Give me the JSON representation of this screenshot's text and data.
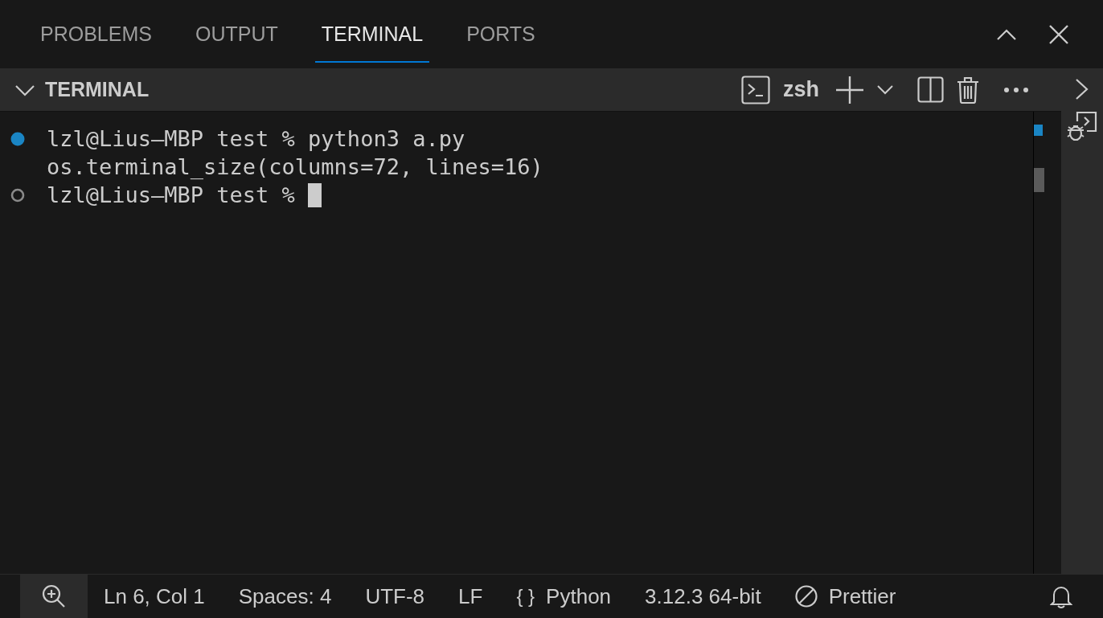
{
  "panel_tabs": [
    {
      "label": "PROBLEMS",
      "selected": false
    },
    {
      "label": "OUTPUT",
      "selected": false
    },
    {
      "label": "TERMINAL",
      "selected": true
    },
    {
      "label": "PORTS",
      "selected": false
    }
  ],
  "terminal_header": {
    "title": "TERMINAL",
    "shell": "zsh"
  },
  "terminal_lines": [
    {
      "kind": "command",
      "text": "lzl@Lius—MBP test % python3 a.py",
      "cursor": false
    },
    {
      "kind": "output",
      "text": "os.terminal_size(columns=72, lines=16)",
      "cursor": false
    },
    {
      "kind": "prompt",
      "text": "lzl@Lius—MBP test % ",
      "cursor": true
    }
  ],
  "status_bar": [
    {
      "kind": "zoom"
    },
    {
      "kind": "text",
      "text": "Ln 6, Col 1"
    },
    {
      "kind": "text",
      "text": "Spaces: 4"
    },
    {
      "kind": "text",
      "text": "UTF-8"
    },
    {
      "kind": "text",
      "text": "LF"
    },
    {
      "kind": "language",
      "glyph": "{ }",
      "text": "Python"
    },
    {
      "kind": "text",
      "text": "3.12.3 64-bit"
    },
    {
      "kind": "prettier",
      "text": "Prettier"
    },
    {
      "kind": "bell"
    }
  ]
}
